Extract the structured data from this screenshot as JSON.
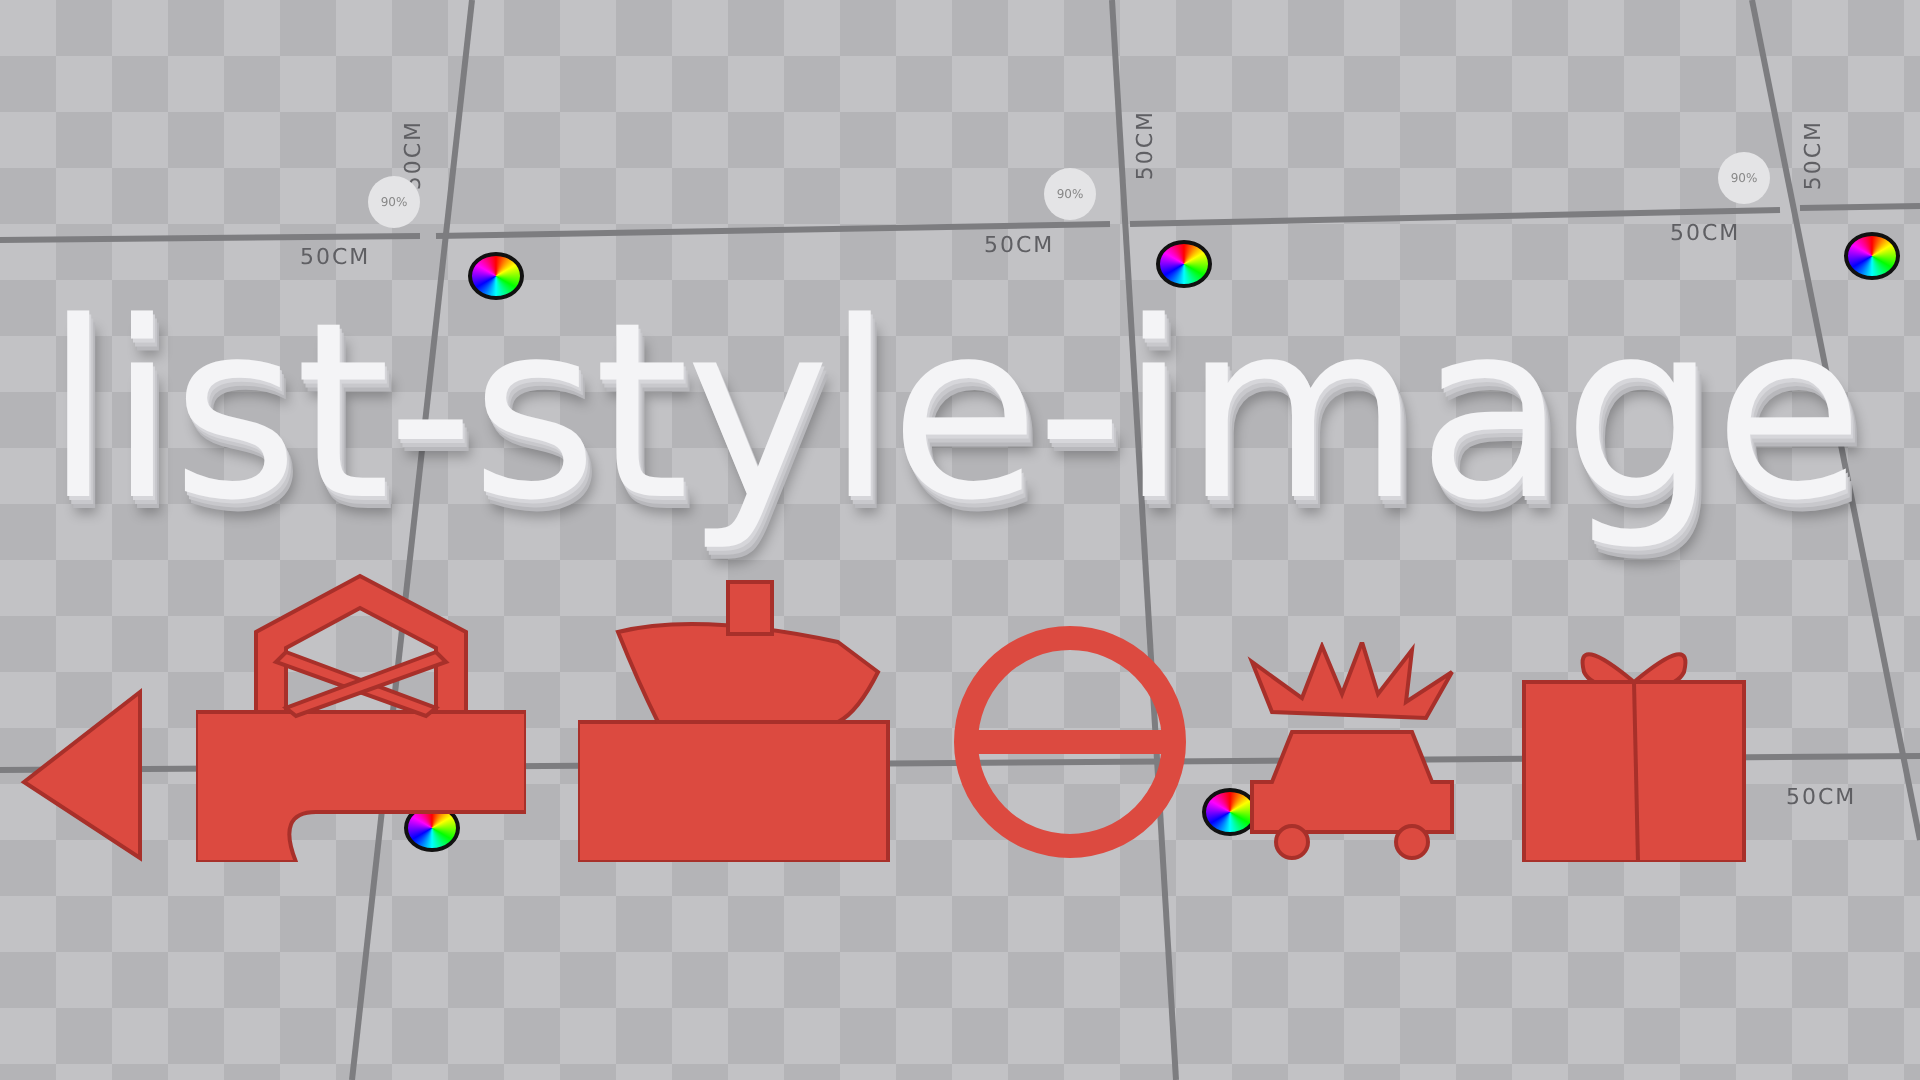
{
  "title": "list-style-image",
  "scale_labels": [
    "50CM",
    "50CM",
    "50CM",
    "50CM",
    "50CM",
    "50CM",
    "50CM"
  ],
  "percent_badges": [
    "90%",
    "90%",
    "90%"
  ]
}
